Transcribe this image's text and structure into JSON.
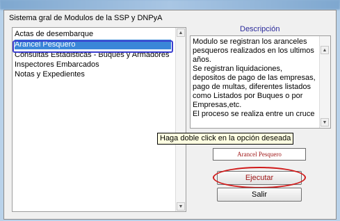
{
  "dialog": {
    "title": "Sistema gral de Modulos de la SSP y DNPyA"
  },
  "modules": {
    "items": [
      "Actas de desembarque",
      "Arancel Pesquero",
      "Consultas Estadisticas - Buques y Armadores",
      "Inspectores Embarcados",
      "Notas y Expedientes"
    ],
    "selected_index": 1
  },
  "description": {
    "header": "Descripción",
    "lines": [
      "Modulo se registran los aranceles",
      "pesqueros realizados en los ultimos",
      "años.",
      "Se registran liquidaciones,",
      "depositos de pago de las empresas,",
      "pago de multas, diferentes listados",
      "como Listados por Buques o por",
      "Empresas,etc.",
      "El proceso se realiza entre un cruce"
    ]
  },
  "tooltip": {
    "text": "Haga doble click en la opción deseada"
  },
  "selection": {
    "label_partial": "los",
    "value": "Arancel Pesquero"
  },
  "buttons": {
    "run_label": "Ejecutar",
    "exit_label": "Salir"
  },
  "colors": {
    "selection_highlight": "#3a86d8",
    "annotation_blue": "#3b3fd0",
    "annotation_red": "#d01a1a",
    "header_text": "#2a2a9a"
  },
  "icons": {
    "scroll_up": "up-arrow-icon",
    "scroll_down": "down-arrow-icon"
  }
}
